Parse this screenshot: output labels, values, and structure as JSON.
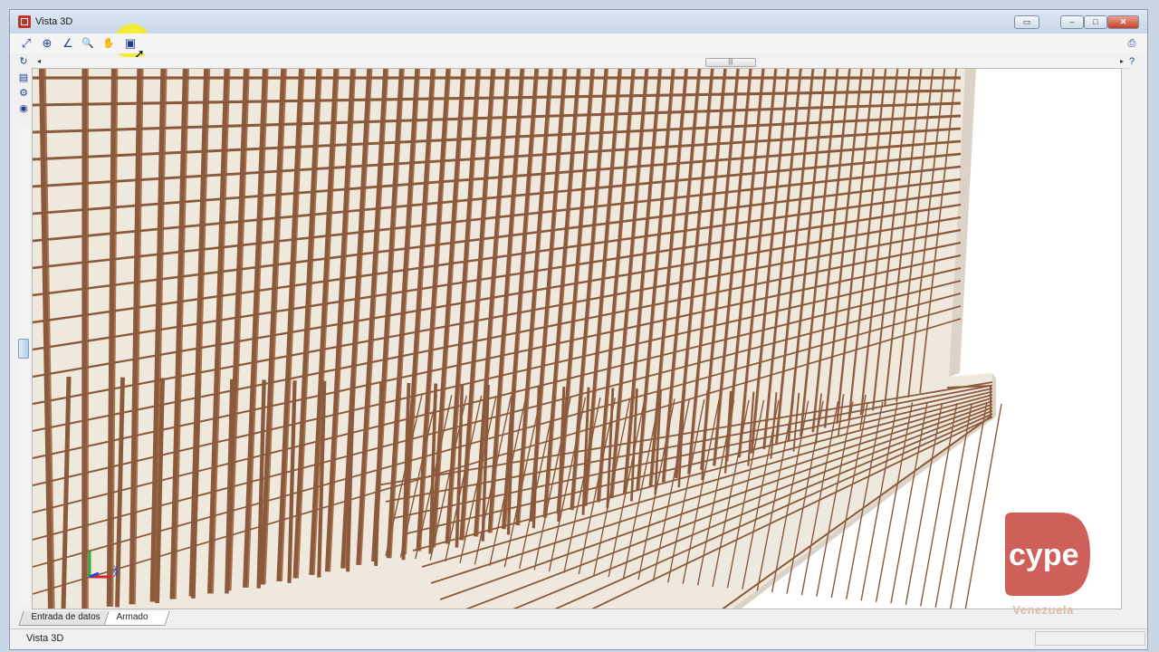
{
  "window": {
    "title": "Vista 3D",
    "controls": {
      "minimize": "–",
      "maximize": "□",
      "close": "✕",
      "restore": "▭"
    }
  },
  "toolbar": {
    "tools": [
      {
        "name": "zoom-window-icon",
        "glyph": "⤢"
      },
      {
        "name": "zoom-all-icon",
        "glyph": "⊕"
      },
      {
        "name": "measure-icon",
        "glyph": "∠"
      },
      {
        "name": "zoom-icon",
        "glyph": "🔍"
      },
      {
        "name": "pan-hand-icon",
        "glyph": "✋"
      },
      {
        "name": "render-window-icon",
        "glyph": "▣"
      }
    ]
  },
  "scroll": {
    "left_arrow": "◂",
    "right_arrow": "▸",
    "thumb_grip": "|||"
  },
  "tabs": [
    {
      "label": "Entrada de datos"
    },
    {
      "label": "Armado"
    }
  ],
  "status": {
    "text": "Vista 3D"
  },
  "watermark": {
    "brand": "cype",
    "sub": "Venezuela"
  },
  "axes": {
    "x": "X",
    "y": "Y"
  },
  "colors": {
    "rebar": "#8b5a3c",
    "rebar_light": "#a9744f",
    "concrete": "#efe8dd",
    "concrete_side": "#dcd3c6",
    "logo": "#c0332a"
  }
}
